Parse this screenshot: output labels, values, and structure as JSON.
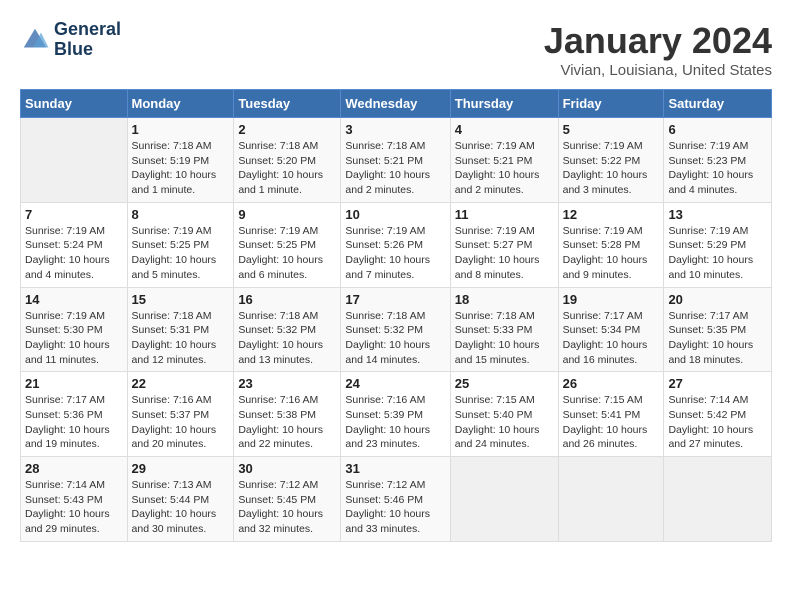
{
  "logo": {
    "line1": "General",
    "line2": "Blue"
  },
  "title": "January 2024",
  "location": "Vivian, Louisiana, United States",
  "days_of_week": [
    "Sunday",
    "Monday",
    "Tuesday",
    "Wednesday",
    "Thursday",
    "Friday",
    "Saturday"
  ],
  "weeks": [
    [
      {
        "day": "",
        "info": ""
      },
      {
        "day": "1",
        "info": "Sunrise: 7:18 AM\nSunset: 5:19 PM\nDaylight: 10 hours\nand 1 minute."
      },
      {
        "day": "2",
        "info": "Sunrise: 7:18 AM\nSunset: 5:20 PM\nDaylight: 10 hours\nand 1 minute."
      },
      {
        "day": "3",
        "info": "Sunrise: 7:18 AM\nSunset: 5:21 PM\nDaylight: 10 hours\nand 2 minutes."
      },
      {
        "day": "4",
        "info": "Sunrise: 7:19 AM\nSunset: 5:21 PM\nDaylight: 10 hours\nand 2 minutes."
      },
      {
        "day": "5",
        "info": "Sunrise: 7:19 AM\nSunset: 5:22 PM\nDaylight: 10 hours\nand 3 minutes."
      },
      {
        "day": "6",
        "info": "Sunrise: 7:19 AM\nSunset: 5:23 PM\nDaylight: 10 hours\nand 4 minutes."
      }
    ],
    [
      {
        "day": "7",
        "info": "Sunrise: 7:19 AM\nSunset: 5:24 PM\nDaylight: 10 hours\nand 4 minutes."
      },
      {
        "day": "8",
        "info": "Sunrise: 7:19 AM\nSunset: 5:25 PM\nDaylight: 10 hours\nand 5 minutes."
      },
      {
        "day": "9",
        "info": "Sunrise: 7:19 AM\nSunset: 5:25 PM\nDaylight: 10 hours\nand 6 minutes."
      },
      {
        "day": "10",
        "info": "Sunrise: 7:19 AM\nSunset: 5:26 PM\nDaylight: 10 hours\nand 7 minutes."
      },
      {
        "day": "11",
        "info": "Sunrise: 7:19 AM\nSunset: 5:27 PM\nDaylight: 10 hours\nand 8 minutes."
      },
      {
        "day": "12",
        "info": "Sunrise: 7:19 AM\nSunset: 5:28 PM\nDaylight: 10 hours\nand 9 minutes."
      },
      {
        "day": "13",
        "info": "Sunrise: 7:19 AM\nSunset: 5:29 PM\nDaylight: 10 hours\nand 10 minutes."
      }
    ],
    [
      {
        "day": "14",
        "info": "Sunrise: 7:19 AM\nSunset: 5:30 PM\nDaylight: 10 hours\nand 11 minutes."
      },
      {
        "day": "15",
        "info": "Sunrise: 7:18 AM\nSunset: 5:31 PM\nDaylight: 10 hours\nand 12 minutes."
      },
      {
        "day": "16",
        "info": "Sunrise: 7:18 AM\nSunset: 5:32 PM\nDaylight: 10 hours\nand 13 minutes."
      },
      {
        "day": "17",
        "info": "Sunrise: 7:18 AM\nSunset: 5:32 PM\nDaylight: 10 hours\nand 14 minutes."
      },
      {
        "day": "18",
        "info": "Sunrise: 7:18 AM\nSunset: 5:33 PM\nDaylight: 10 hours\nand 15 minutes."
      },
      {
        "day": "19",
        "info": "Sunrise: 7:17 AM\nSunset: 5:34 PM\nDaylight: 10 hours\nand 16 minutes."
      },
      {
        "day": "20",
        "info": "Sunrise: 7:17 AM\nSunset: 5:35 PM\nDaylight: 10 hours\nand 18 minutes."
      }
    ],
    [
      {
        "day": "21",
        "info": "Sunrise: 7:17 AM\nSunset: 5:36 PM\nDaylight: 10 hours\nand 19 minutes."
      },
      {
        "day": "22",
        "info": "Sunrise: 7:16 AM\nSunset: 5:37 PM\nDaylight: 10 hours\nand 20 minutes."
      },
      {
        "day": "23",
        "info": "Sunrise: 7:16 AM\nSunset: 5:38 PM\nDaylight: 10 hours\nand 22 minutes."
      },
      {
        "day": "24",
        "info": "Sunrise: 7:16 AM\nSunset: 5:39 PM\nDaylight: 10 hours\nand 23 minutes."
      },
      {
        "day": "25",
        "info": "Sunrise: 7:15 AM\nSunset: 5:40 PM\nDaylight: 10 hours\nand 24 minutes."
      },
      {
        "day": "26",
        "info": "Sunrise: 7:15 AM\nSunset: 5:41 PM\nDaylight: 10 hours\nand 26 minutes."
      },
      {
        "day": "27",
        "info": "Sunrise: 7:14 AM\nSunset: 5:42 PM\nDaylight: 10 hours\nand 27 minutes."
      }
    ],
    [
      {
        "day": "28",
        "info": "Sunrise: 7:14 AM\nSunset: 5:43 PM\nDaylight: 10 hours\nand 29 minutes."
      },
      {
        "day": "29",
        "info": "Sunrise: 7:13 AM\nSunset: 5:44 PM\nDaylight: 10 hours\nand 30 minutes."
      },
      {
        "day": "30",
        "info": "Sunrise: 7:12 AM\nSunset: 5:45 PM\nDaylight: 10 hours\nand 32 minutes."
      },
      {
        "day": "31",
        "info": "Sunrise: 7:12 AM\nSunset: 5:46 PM\nDaylight: 10 hours\nand 33 minutes."
      },
      {
        "day": "",
        "info": ""
      },
      {
        "day": "",
        "info": ""
      },
      {
        "day": "",
        "info": ""
      }
    ]
  ]
}
